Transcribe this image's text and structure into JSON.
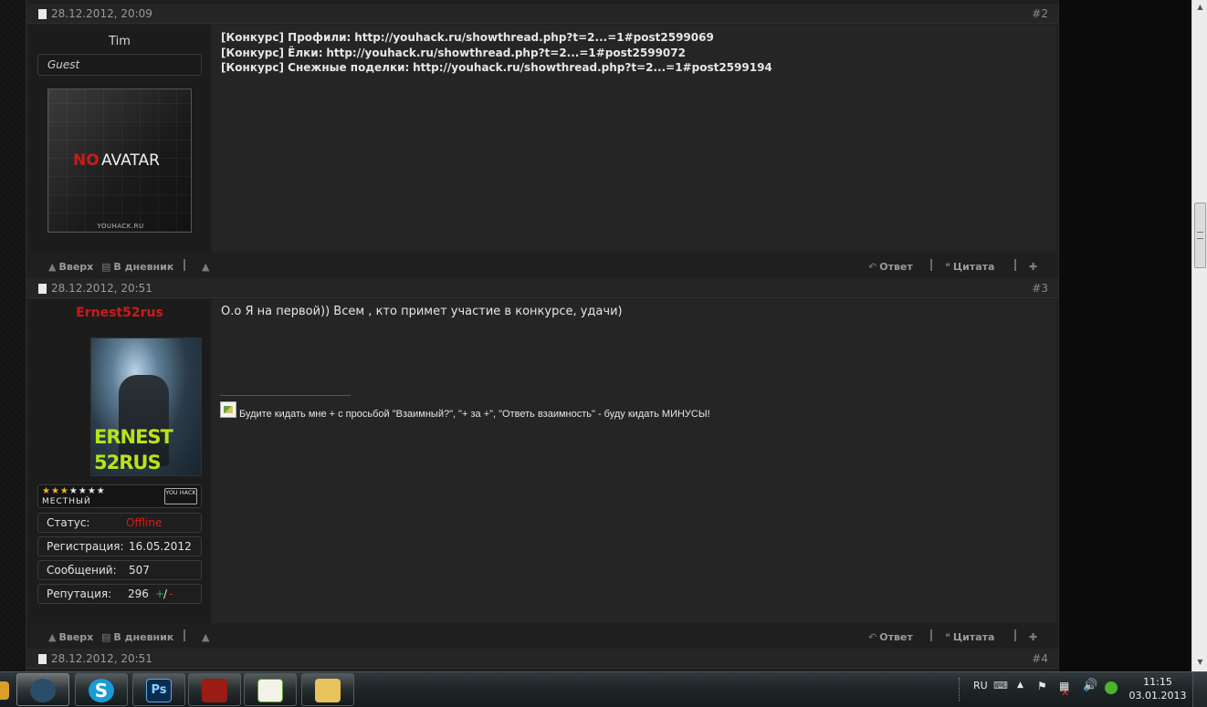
{
  "posts": [
    {
      "date": "28.12.2012, 20:09",
      "number": "#2",
      "author": "Tim",
      "user_title": "Guest",
      "avatar": {
        "no": "NO",
        "avatar": "AVATAR",
        "site": "YOUHACK.RU"
      },
      "lines": [
        {
          "label": "[Конкурс] Профили:",
          "url": "http://youhack.ru/showthread.php?t=2...=1#post2599069"
        },
        {
          "label": "[Конкурс] Ёлки:",
          "url": "http://youhack.ru/showthread.php?t=2...=1#post2599072"
        },
        {
          "label": "[Конкурс] Снежные поделки:",
          "url": "http://youhack.ru/showthread.php?t=2...=1#post2599194"
        }
      ]
    },
    {
      "date": "28.12.2012, 20:51",
      "number": "#3",
      "author": "Ernest52rus",
      "author_color": "#cc1a1a",
      "avatar_text": [
        "ERNEST",
        "52RUS"
      ],
      "rank_label": "МЕСТНЫЙ",
      "stars_on": 3,
      "stars_total": 7,
      "badge": "YOU HACK",
      "stats": [
        {
          "label": "Статус:",
          "value": "Offline"
        },
        {
          "label": "Регистрация:",
          "value": "16.05.2012"
        },
        {
          "label": "Сообщений:",
          "value": "507"
        },
        {
          "label": "Репутация:",
          "value": "296",
          "plus": "+",
          "slash": "/",
          "minus": "-"
        }
      ],
      "message": "О.о Я на первой)) Всем , кто примет участие в конкурсе, удачи)",
      "signature": "Будите кидать мне + с просьбой \"Взаимный?\", \"+ за +\", \"Ответь взаимность\" - буду кидать МИНУСЫ!"
    },
    {
      "date": "28.12.2012, 20:51",
      "number": "#4"
    }
  ],
  "footer": {
    "up": "Вверх",
    "diary": "В дневник",
    "reply": "Ответ",
    "quote": "Цитата"
  },
  "taskbar": {
    "apps": [
      {
        "name": "Steam",
        "color": "#2a4d6a"
      },
      {
        "name": "Skype",
        "color": "#1a9bd7"
      },
      {
        "name": "Photoshop",
        "label": "Ps",
        "color": "#0a2c52"
      },
      {
        "name": "Dota 2",
        "color": "#9a1c14"
      },
      {
        "name": "Notepad++",
        "color": "#5aa02a"
      },
      {
        "name": "Explorer",
        "color": "#e8c25a"
      }
    ],
    "lang": "RU",
    "time": "11:15",
    "date": "03.01.2013"
  },
  "colors": {
    "offline": "#d61c1c",
    "rep_plus": "#3aa23a",
    "rep_minus": "#cc2a2a"
  }
}
